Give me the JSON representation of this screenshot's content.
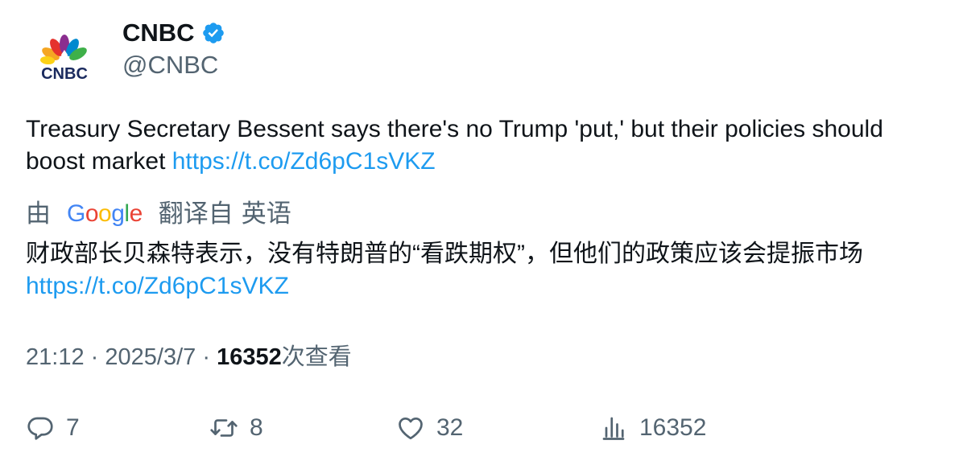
{
  "author": {
    "display_name": "CNBC",
    "handle": "@CNBC",
    "avatar_logo_text": "CNBC",
    "verified_icon": "verified-badge-icon",
    "verified_color": "#1d9bf0"
  },
  "tweet": {
    "text": "Treasury Secretary Bessent says there's no Trump 'put,' but their policies should boost market ",
    "link": "https://t.co/Zd6pC1sVKZ"
  },
  "translation": {
    "by_prefix": "由",
    "provider": [
      "G",
      "o",
      "o",
      "g",
      "l",
      "e"
    ],
    "provider_colors": [
      "#4285F4",
      "#EA4335",
      "#FBBC05",
      "#4285F4",
      "#34A853",
      "#EA4335"
    ],
    "translated_from": "翻译自",
    "language": "英语",
    "text": "财政部长贝森特表示，没有特朗普的“看跌期权”，但他们的政策应该会提振市场",
    "link": "https://t.co/Zd6pC1sVKZ"
  },
  "meta": {
    "time": "21:12",
    "separator": "·",
    "date": "2025/3/7",
    "views_count": "16352",
    "views_label": "次查看"
  },
  "actions": {
    "reply": {
      "icon": "reply-icon",
      "count": "7"
    },
    "retweet": {
      "icon": "retweet-icon",
      "count": "8"
    },
    "like": {
      "icon": "heart-icon",
      "count": "32"
    },
    "views": {
      "icon": "analytics-icon",
      "count": "16352"
    }
  },
  "colors": {
    "link": "#1d9bf0",
    "secondary_text": "#536471",
    "primary_text": "#0f1419"
  }
}
